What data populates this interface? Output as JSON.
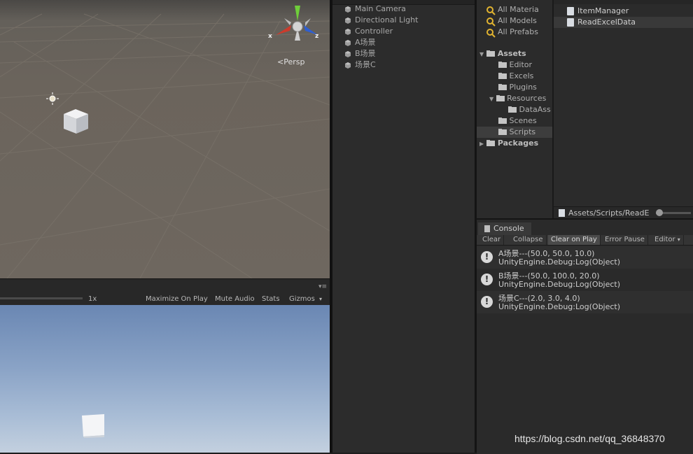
{
  "scene": {
    "projection_label": "Persp",
    "axes": {
      "x": "x",
      "z": "z"
    }
  },
  "game_toolbar": {
    "scale": "1x",
    "buttons": [
      "Maximize On Play",
      "Mute Audio",
      "Stats",
      "Gizmos"
    ]
  },
  "hierarchy": {
    "items": [
      "Main Camera",
      "Directional Light",
      "Controller",
      "A场景",
      "B场景",
      "场景C"
    ]
  },
  "project": {
    "favorites": [
      "All Materia",
      "All Models",
      "All Prefabs"
    ],
    "assets_label": "Assets",
    "asset_folders": [
      "Editor",
      "Excels",
      "Plugins",
      "Resources",
      "Scenes",
      "Scripts"
    ],
    "resources_child": "DataAss",
    "packages_label": "Packages",
    "files": [
      "ItemManager",
      "ReadExcelData"
    ],
    "path": "Assets/Scripts/ReadE"
  },
  "console": {
    "tab": "Console",
    "buttons": [
      "Clear",
      "Collapse",
      "Clear on Play",
      "Error Pause",
      "Editor"
    ],
    "logs": [
      {
        "line1": "A场景---(50.0, 50.0, 10.0)",
        "line2": "UnityEngine.Debug:Log(Object)"
      },
      {
        "line1": "B场景---(50.0, 100.0, 20.0)",
        "line2": "UnityEngine.Debug:Log(Object)"
      },
      {
        "line1": "场景C---(2.0, 3.0, 4.0)",
        "line2": "UnityEngine.Debug:Log(Object)"
      }
    ]
  },
  "watermark": "https://blog.csdn.net/qq_36848370"
}
